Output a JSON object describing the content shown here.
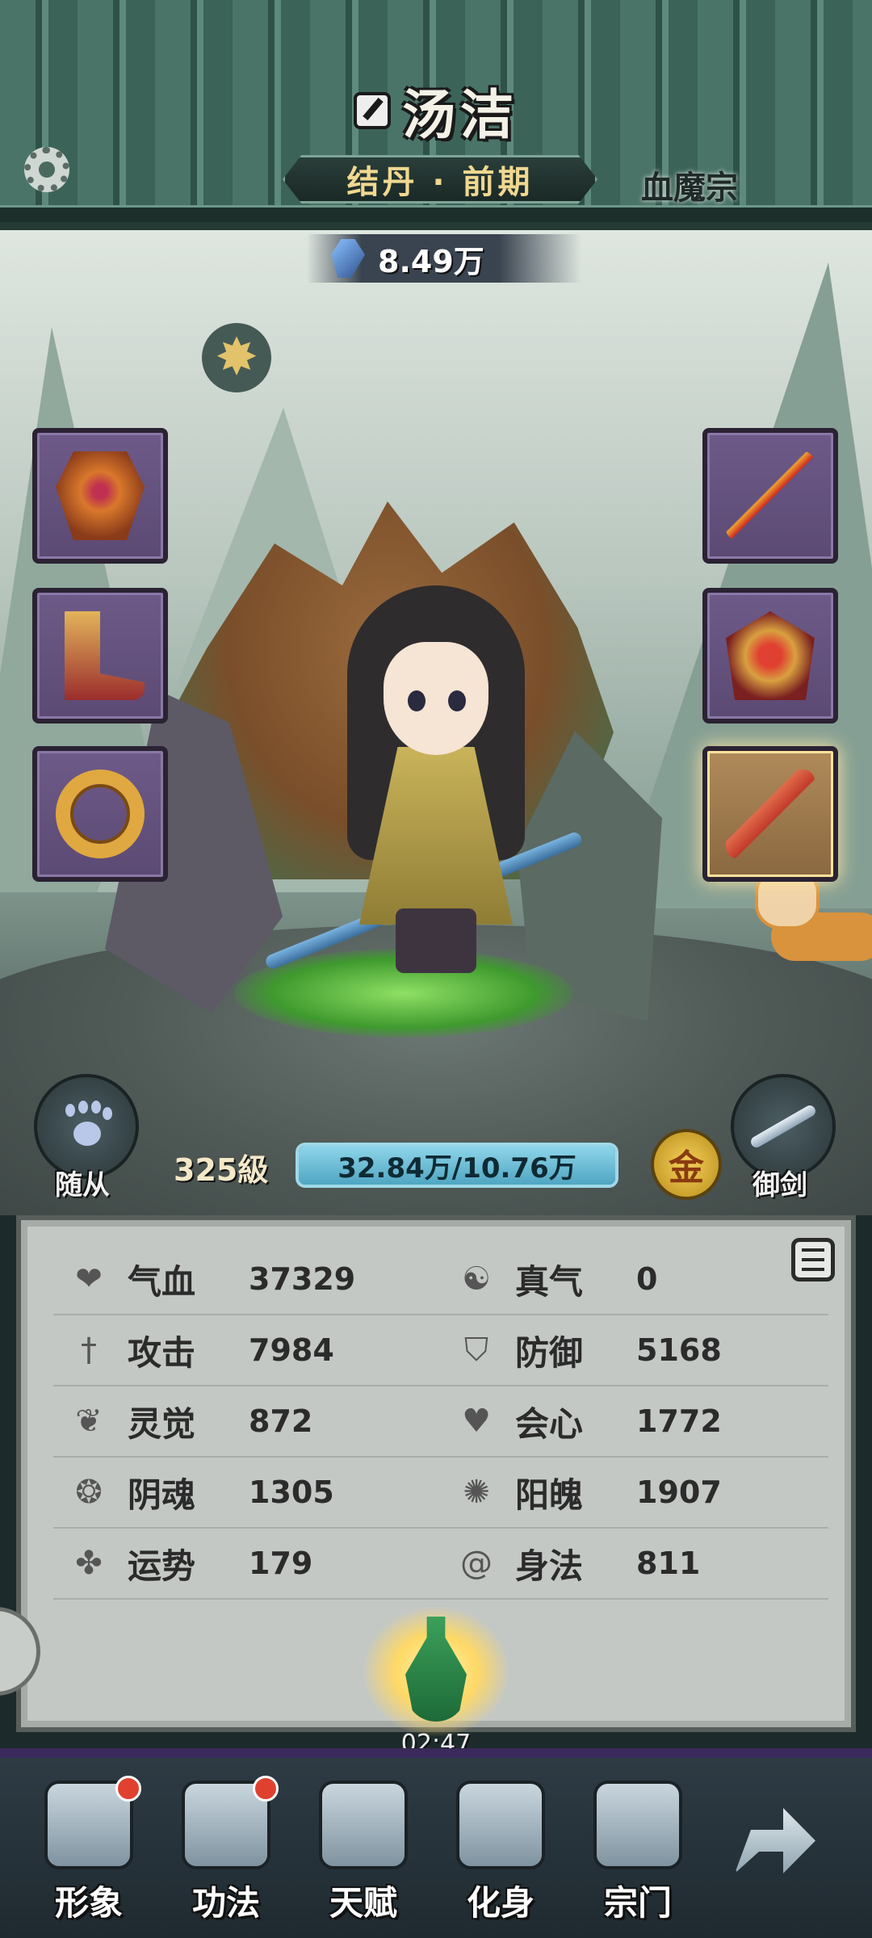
{
  "header": {
    "player_name": "汤洁",
    "realm": "结丹 · 前期",
    "sect": "血魔宗"
  },
  "power": {
    "value": "8.49万"
  },
  "level": {
    "label": "325級",
    "exp_text": "32.84万/10.76万",
    "exp_fraction": 1.0
  },
  "gold_button": {
    "label": "金"
  },
  "side_buttons": {
    "follower_label": "随从",
    "flying_sword_label": "御剑"
  },
  "stats": [
    {
      "left": {
        "icon": "heart-icon",
        "label": "气血",
        "value": "37329"
      },
      "right": {
        "icon": "yin-yang-icon",
        "label": "真气",
        "value": "0"
      }
    },
    {
      "left": {
        "icon": "sword-icon",
        "label": "攻击",
        "value": "7984"
      },
      "right": {
        "icon": "shield-icon",
        "label": "防御",
        "value": "5168"
      }
    },
    {
      "left": {
        "icon": "lotus-icon",
        "label": "灵觉",
        "value": "872"
      },
      "right": {
        "icon": "crit-heart-icon",
        "label": "会心",
        "value": "1772"
      }
    },
    {
      "left": {
        "icon": "yin-soul-icon",
        "label": "阴魂",
        "value": "1305"
      },
      "right": {
        "icon": "yang-soul-icon",
        "label": "阳魄",
        "value": "1907"
      }
    },
    {
      "left": {
        "icon": "clover-icon",
        "label": "运势",
        "value": "179"
      },
      "right": {
        "icon": "swirl-icon",
        "label": "身法",
        "value": "811"
      }
    }
  ],
  "timer": "02:47",
  "nav": [
    {
      "label": "形象",
      "icon": "robe-icon",
      "badge": true
    },
    {
      "label": "功法",
      "icon": "book-icon",
      "badge": true
    },
    {
      "label": "天赋",
      "icon": "spiral-icon",
      "badge": false
    },
    {
      "label": "化身",
      "icon": "avatar-icon",
      "badge": false
    },
    {
      "label": "宗门",
      "icon": "sect-icon",
      "badge": false
    }
  ],
  "colors": {
    "header_green": "#4a7468",
    "slot_purple": "#6e5a88",
    "exp_blue": "#8fd6ea",
    "realm_gold": "#f0d890",
    "badge_red": "#e0412f"
  }
}
